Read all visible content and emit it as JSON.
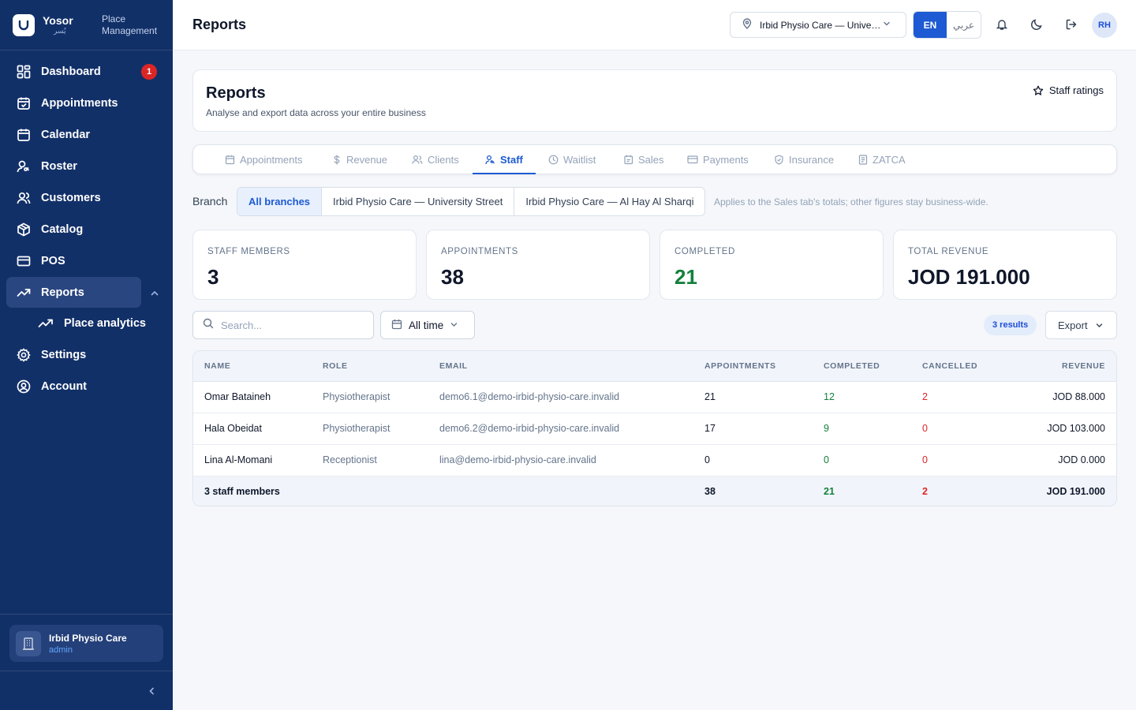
{
  "brand": {
    "name": "Yosor",
    "name_ar": "يُسر",
    "subtitle": "Place Management"
  },
  "sidebar": {
    "items": [
      {
        "label": "Dashboard",
        "icon": "dashboard-icon",
        "badge": "1"
      },
      {
        "label": "Appointments",
        "icon": "calendar-check-icon"
      },
      {
        "label": "Calendar",
        "icon": "calendar-icon"
      },
      {
        "label": "Roster",
        "icon": "user-key-icon"
      },
      {
        "label": "Customers",
        "icon": "users-icon"
      },
      {
        "label": "Catalog",
        "icon": "box-icon"
      },
      {
        "label": "POS",
        "icon": "credit-card-icon"
      },
      {
        "label": "Reports",
        "icon": "trending-up-icon",
        "active": true
      },
      {
        "label": "Place analytics",
        "icon": "trending-up-icon"
      },
      {
        "label": "Settings",
        "icon": "gear-icon"
      },
      {
        "label": "Account",
        "icon": "user-circle-icon"
      }
    ],
    "org": {
      "name": "Irbid Physio Care",
      "role": "admin"
    }
  },
  "header": {
    "title": "Reports",
    "place": "Irbid Physio Care — University Street",
    "lang_en": "EN",
    "lang_ar": "عربي",
    "avatar": "RH"
  },
  "page": {
    "title": "Reports",
    "subtitle": "Analyse and export data across your entire business",
    "staff_ratings": "Staff ratings"
  },
  "tabs": [
    {
      "label": "Appointments",
      "icon": "calendar-icon"
    },
    {
      "label": "Revenue",
      "icon": "dollar-icon"
    },
    {
      "label": "Clients",
      "icon": "users-icon"
    },
    {
      "label": "Staff",
      "icon": "user-key-icon",
      "active": true
    },
    {
      "label": "Waitlist",
      "icon": "clock-icon"
    },
    {
      "label": "Sales",
      "icon": "receipt-icon"
    },
    {
      "label": "Payments",
      "icon": "credit-card-icon"
    },
    {
      "label": "Insurance",
      "icon": "shield-check-icon"
    },
    {
      "label": "ZATCA",
      "icon": "document-icon"
    }
  ],
  "branch": {
    "label": "Branch",
    "options": [
      "All branches",
      "Irbid Physio Care — University Street",
      "Irbid Physio Care — Al Hay Al Sharqi"
    ],
    "selected": "All branches",
    "note": "Applies to the Sales tab's totals; other figures stay business-wide."
  },
  "stats": [
    {
      "label": "STAFF MEMBERS",
      "value": "3"
    },
    {
      "label": "APPOINTMENTS",
      "value": "38"
    },
    {
      "label": "COMPLETED",
      "value": "21"
    },
    {
      "label": "TOTAL REVENUE",
      "value": "JOD 191.000"
    }
  ],
  "filters": {
    "search_placeholder": "Search...",
    "range": "All time",
    "results": "3 results",
    "export": "Export"
  },
  "table": {
    "headers": [
      "NAME",
      "ROLE",
      "EMAIL",
      "APPOINTMENTS",
      "COMPLETED",
      "CANCELLED",
      "REVENUE"
    ],
    "rows": [
      {
        "name": "Omar Bataineh",
        "role": "Physiotherapist",
        "email": "demo6.1@demo-irbid-physio-care.invalid",
        "appointments": "21",
        "completed": "12",
        "cancelled": "2",
        "revenue": "JOD 88.000"
      },
      {
        "name": "Hala Obeidat",
        "role": "Physiotherapist",
        "email": "demo6.2@demo-irbid-physio-care.invalid",
        "appointments": "17",
        "completed": "9",
        "cancelled": "0",
        "revenue": "JOD 103.000"
      },
      {
        "name": "Lina Al-Momani",
        "role": "Receptionist",
        "email": "lina@demo-irbid-physio-care.invalid",
        "appointments": "0",
        "completed": "0",
        "cancelled": "0",
        "revenue": "JOD 0.000"
      }
    ],
    "total": {
      "label": "3 staff members",
      "appointments": "38",
      "completed": "21",
      "cancelled": "2",
      "revenue": "JOD 191.000"
    }
  },
  "colors": {
    "sidebar": "#123068",
    "accent": "#1d5ad3",
    "success": "#15803d",
    "danger": "#dc2626"
  }
}
